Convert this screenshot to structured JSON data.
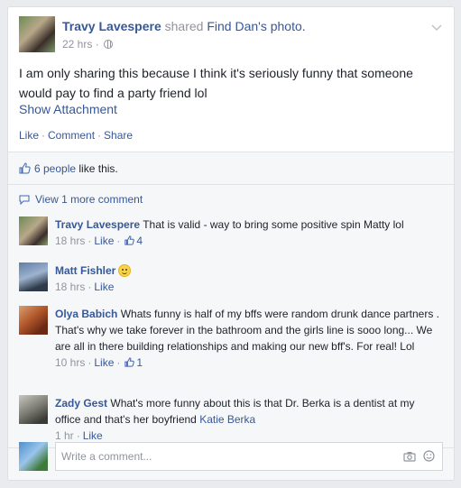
{
  "post": {
    "author": "Travy Lavespere",
    "shared_text": "shared",
    "target_text": "Find Dan's",
    "target_suffix": "photo.",
    "time": "22 hrs",
    "body": "I am only sharing this because I think it's seriously funny that someone would pay to find a party friend lol",
    "attachment_label": "Show Attachment",
    "actions": {
      "like": "Like",
      "comment": "Comment",
      "share": "Share"
    }
  },
  "likes": {
    "count_text": "6 people",
    "suffix": "like this."
  },
  "view_more": "View 1 more comment",
  "comments": [
    {
      "author": "Travy Lavespere",
      "text": "That is valid - way to bring some positive spin Matty lol",
      "time": "18 hrs",
      "like_label": "Like",
      "like_count": "4"
    },
    {
      "author": "Matt Fishler",
      "text": "",
      "time": "18 hrs",
      "like_label": "Like",
      "like_count": ""
    },
    {
      "author": "Olya Babich",
      "text": "Whats funny is half of my bffs were random drunk dance partners . That's why we take forever in the bathroom and the girls line is sooo long... We are all in there building relationships and making our new bff's. For real! Lol",
      "time": "10 hrs",
      "like_label": "Like",
      "like_count": "1"
    },
    {
      "author": "Zady Gest",
      "text": "What's more funny about this is that Dr. Berka is a dentist at my office and that's her boyfriend",
      "tag": "Katie Berka",
      "time": "1 hr",
      "like_label": "Like",
      "like_count": ""
    }
  ],
  "write": {
    "placeholder": "Write a comment..."
  },
  "colors": {
    "link": "#365899",
    "meta": "#90949c",
    "bg": "#f6f7f9"
  }
}
